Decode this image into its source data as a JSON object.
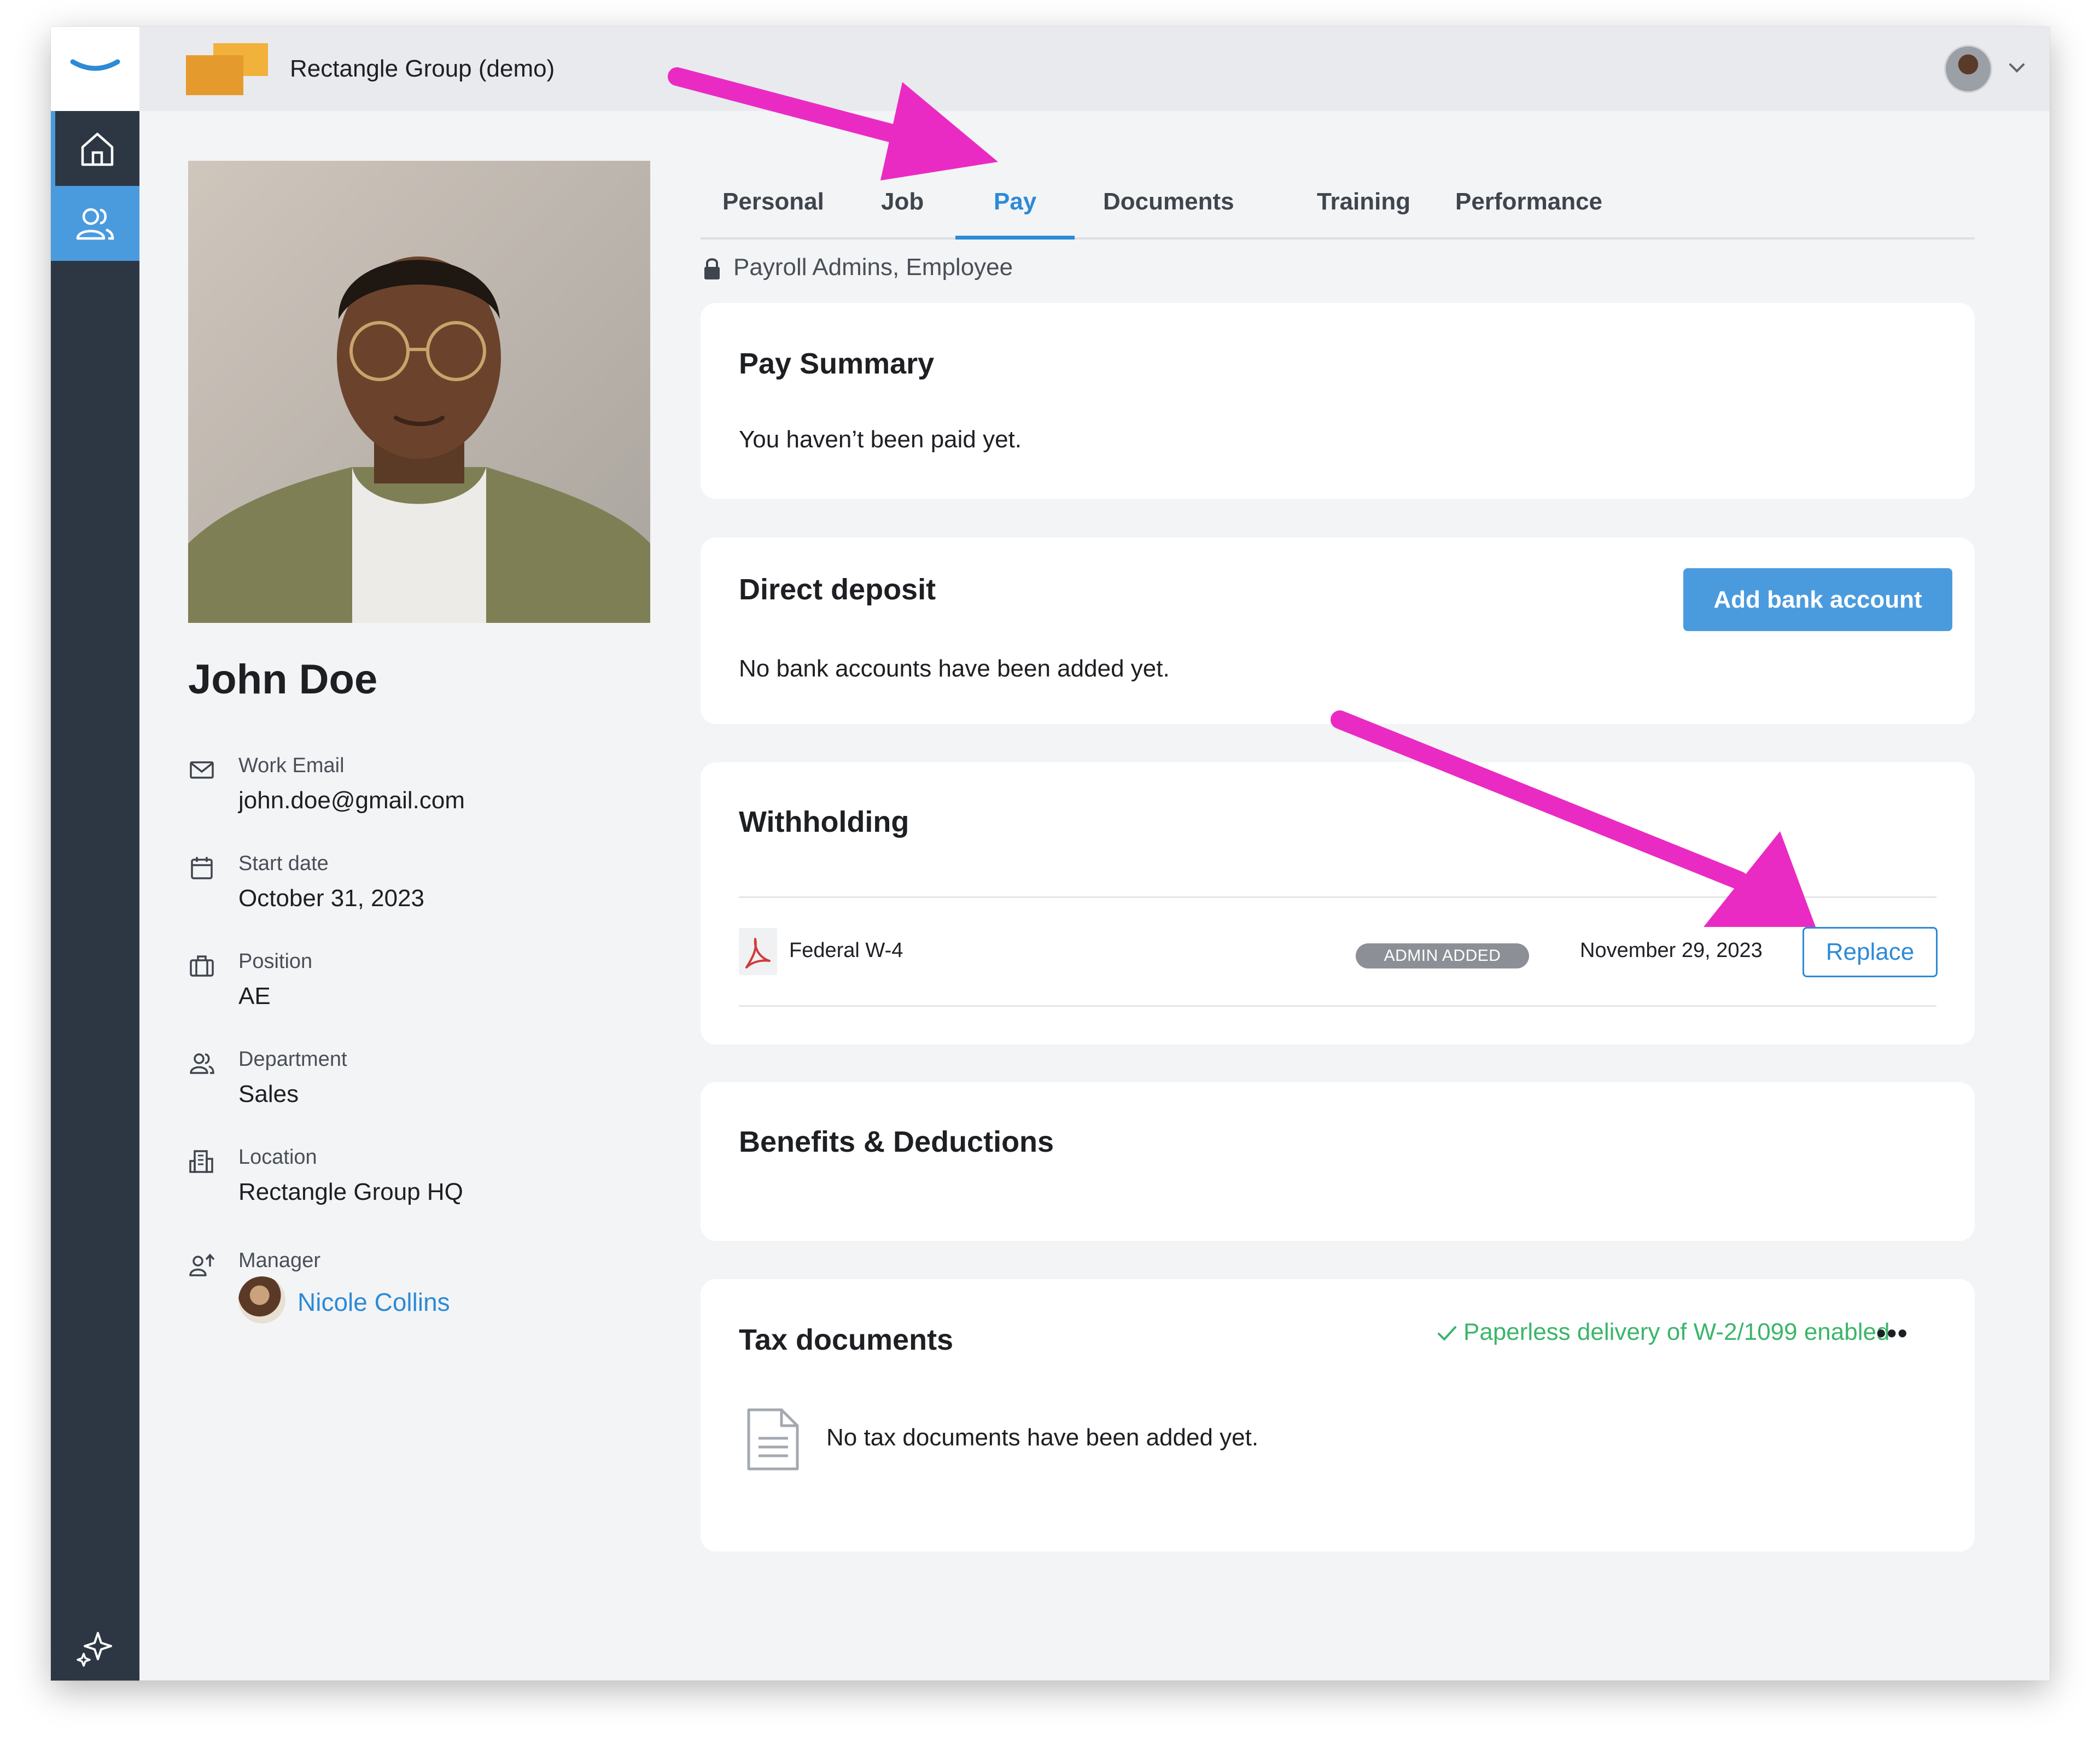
{
  "company": {
    "name": "Rectangle Group (demo)"
  },
  "employee": {
    "name": "John Doe",
    "fields": [
      {
        "label": "Work Email",
        "value": "john.doe@gmail.com",
        "icon": "envelope-icon"
      },
      {
        "label": "Start date",
        "value": "October 31, 2023",
        "icon": "calendar-icon"
      },
      {
        "label": "Position",
        "value": "AE",
        "icon": "briefcase-icon"
      },
      {
        "label": "Department",
        "value": "Sales",
        "icon": "people-icon"
      },
      {
        "label": "Location",
        "value": "Rectangle Group HQ",
        "icon": "building-icon"
      },
      {
        "label": "Manager",
        "value": "Nicole Collins",
        "icon": "manager-icon"
      }
    ]
  },
  "tabs": [
    "Personal",
    "Job",
    "Pay",
    "Documents",
    "Training",
    "Performance"
  ],
  "active_tab": "Pay",
  "access": "Payroll Admins, Employee",
  "pay_summary": {
    "title": "Pay Summary",
    "text": "You haven’t been paid yet."
  },
  "direct_deposit": {
    "title": "Direct deposit",
    "text": "No bank accounts have been added yet.",
    "button": "Add bank account"
  },
  "withholding": {
    "title": "Withholding",
    "document": "Federal W-4",
    "badge": "ADMIN ADDED",
    "date": "November 29, 2023",
    "button": "Replace"
  },
  "benefits": {
    "title": "Benefits & Deductions"
  },
  "tax_documents": {
    "title": "Tax documents",
    "status": "Paperless delivery of W-2/1099 enabled",
    "more": "•••",
    "empty_text": "No tax documents have been added yet."
  },
  "colors": {
    "accent": "#4a9bde",
    "link": "#2d8ad6",
    "sidebar": "#2d3743",
    "success": "#3bb56a",
    "annotation": "#ea2bc3"
  }
}
